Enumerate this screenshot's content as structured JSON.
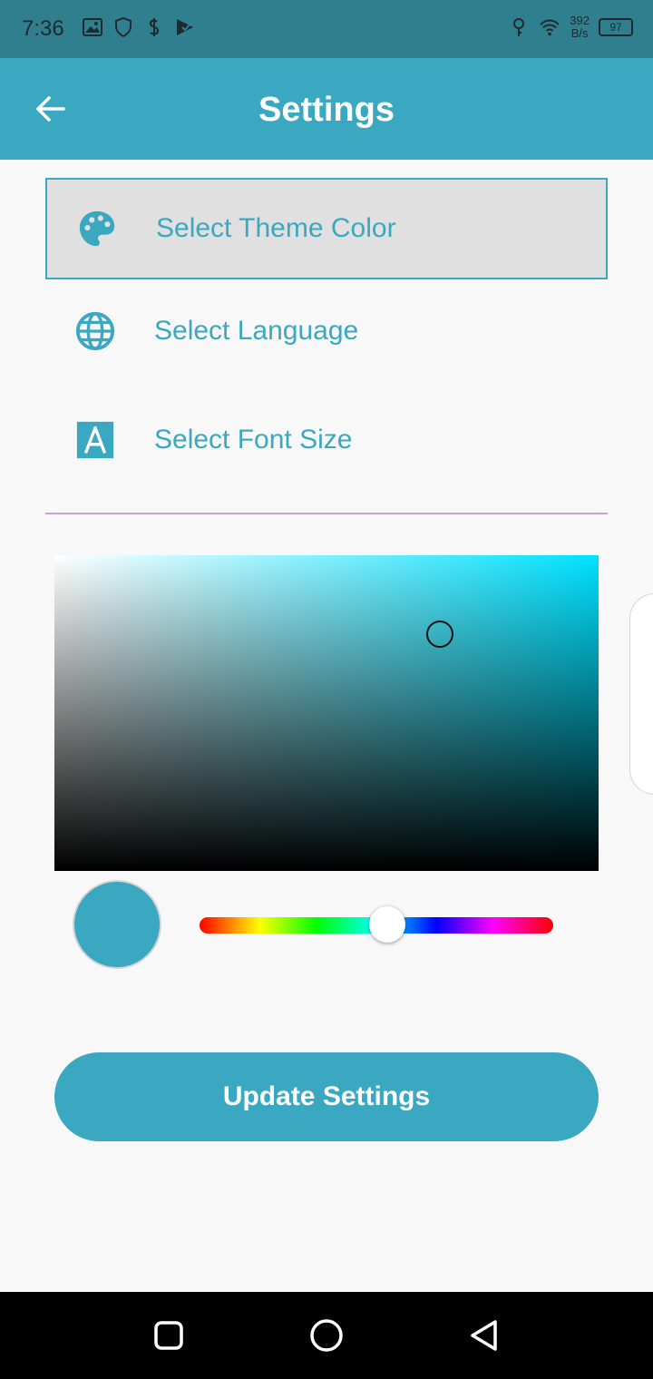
{
  "status_bar": {
    "time": "7:36",
    "net_speed_value": "392",
    "net_speed_unit": "B/s",
    "battery": "97",
    "icons": [
      "image-icon",
      "shield-icon",
      "dollar-icon",
      "play-check-icon",
      "wifi-icon",
      "key-icon"
    ]
  },
  "app_bar": {
    "title": "Settings",
    "back_icon": "arrow-left-icon"
  },
  "menu": {
    "items": [
      {
        "label": "Select Theme Color",
        "icon": "palette-icon",
        "selected": true
      },
      {
        "label": "Select Language",
        "icon": "globe-icon",
        "selected": false
      },
      {
        "label": "Select Font Size",
        "icon": "font-size-icon",
        "selected": false
      }
    ]
  },
  "color_picker": {
    "hue_color": "#00e1ff",
    "selected_color": "#3aa8c1",
    "hue_level": 0.53
  },
  "actions": {
    "update_label": "Update Settings"
  },
  "colors": {
    "primary": "#3aa8c1",
    "status_bar": "#2f7f8f",
    "divider": "#c99fd6"
  },
  "nav_bar": {
    "icons": [
      "recents-icon",
      "home-icon",
      "back-icon"
    ]
  }
}
